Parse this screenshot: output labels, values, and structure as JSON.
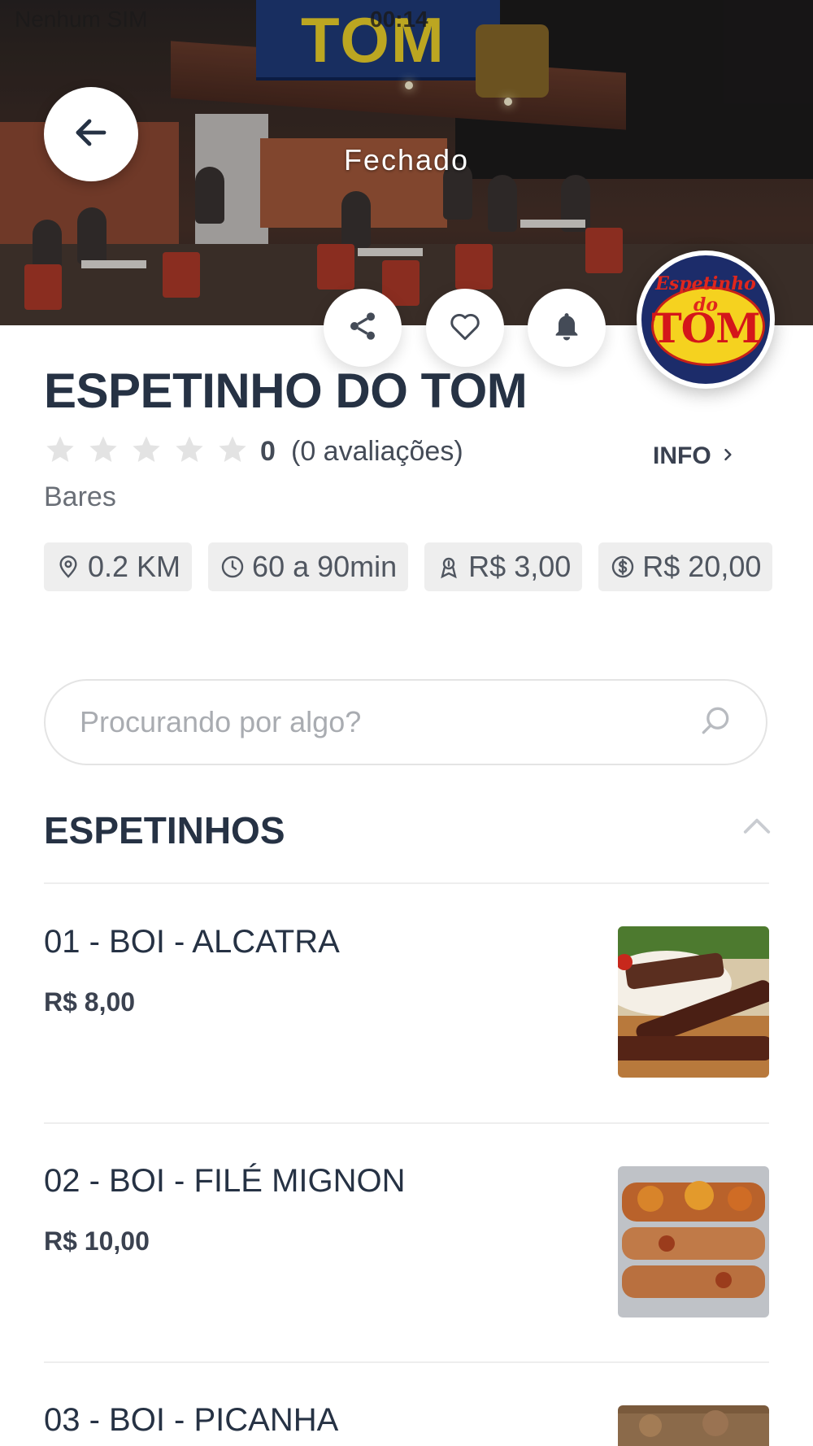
{
  "status_bar": {
    "carrier": "Nenhum SIM",
    "time": "00:14"
  },
  "hero": {
    "sign_text": "TOM",
    "status": "Fechado",
    "logo": {
      "top_text": "Espetinho do",
      "main_text": "TOM"
    }
  },
  "store": {
    "name": "ESPETINHO DO TOM",
    "rating": {
      "score": "0",
      "count_text": "(0 avaliações)",
      "stars_filled": 0,
      "stars_total": 5
    },
    "info_label": "INFO",
    "category": "Bares",
    "chips": [
      {
        "icon": "location-pin-icon",
        "text": "0.2 KM"
      },
      {
        "icon": "clock-icon",
        "text": "60 a 90min"
      },
      {
        "icon": "delivery-fee-icon",
        "text": "R$ 3,00"
      },
      {
        "icon": "dollar-circle-icon",
        "text": "R$ 20,00"
      }
    ]
  },
  "search": {
    "placeholder": "Procurando por algo?"
  },
  "menu": {
    "section_title": "ESPETINHOS",
    "items": [
      {
        "name": "01 - BOI - ALCATRA",
        "price": "R$ 8,00"
      },
      {
        "name": "02 - BOI - FILÉ MIGNON",
        "price": "R$ 10,00"
      },
      {
        "name": "03 - BOI - PICANHA",
        "price": ""
      }
    ]
  },
  "colors": {
    "text_primary": "#263244",
    "chip_bg": "#eeeeee",
    "star_empty": "#e3e3e3"
  }
}
